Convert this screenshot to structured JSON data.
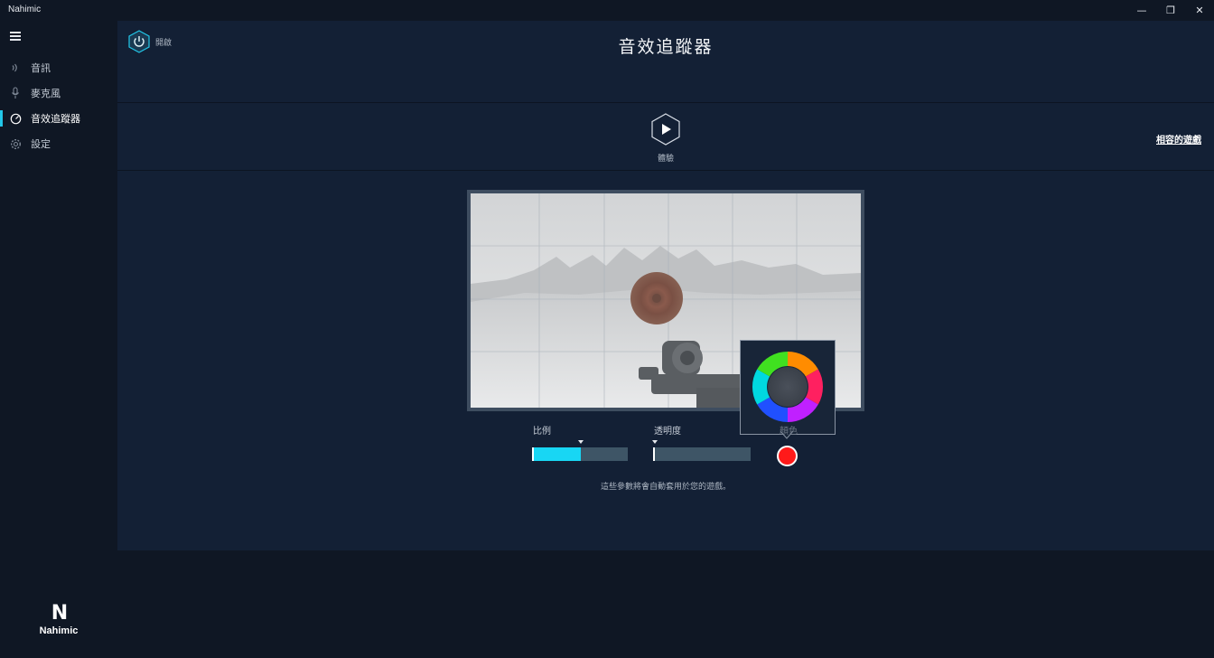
{
  "app": {
    "title": "Nahimic"
  },
  "window_controls": {
    "minimize": "—",
    "restore": "❐",
    "close": "✕"
  },
  "sidebar": {
    "items": [
      {
        "label": "音訊",
        "icon": "speaker-icon",
        "active": false
      },
      {
        "label": "麥克風",
        "icon": "microphone-icon",
        "active": false
      },
      {
        "label": "音效追蹤器",
        "icon": "sound-tracker-icon",
        "active": true
      },
      {
        "label": "設定",
        "icon": "gear-icon",
        "active": false
      }
    ],
    "logo": {
      "mark": "N",
      "text": "Nahimic"
    }
  },
  "header": {
    "power_label": "開啟",
    "title": "音效追蹤器"
  },
  "experience": {
    "play_label": "體驗",
    "compat_link": "相容的遊戲"
  },
  "controls": {
    "scale": {
      "label": "比例",
      "value_fraction": 0.51
    },
    "opacity": {
      "label": "透明度",
      "value_fraction": 0.02
    },
    "color": {
      "label": "顏色",
      "value": "#ff1a1a"
    }
  },
  "note": "這些參數將會自動套用於您的遊戲。",
  "colors": {
    "accent": "#18d6f4",
    "background": "#0f1724",
    "panel": "#132035",
    "indicator": "#ff1a1a"
  }
}
